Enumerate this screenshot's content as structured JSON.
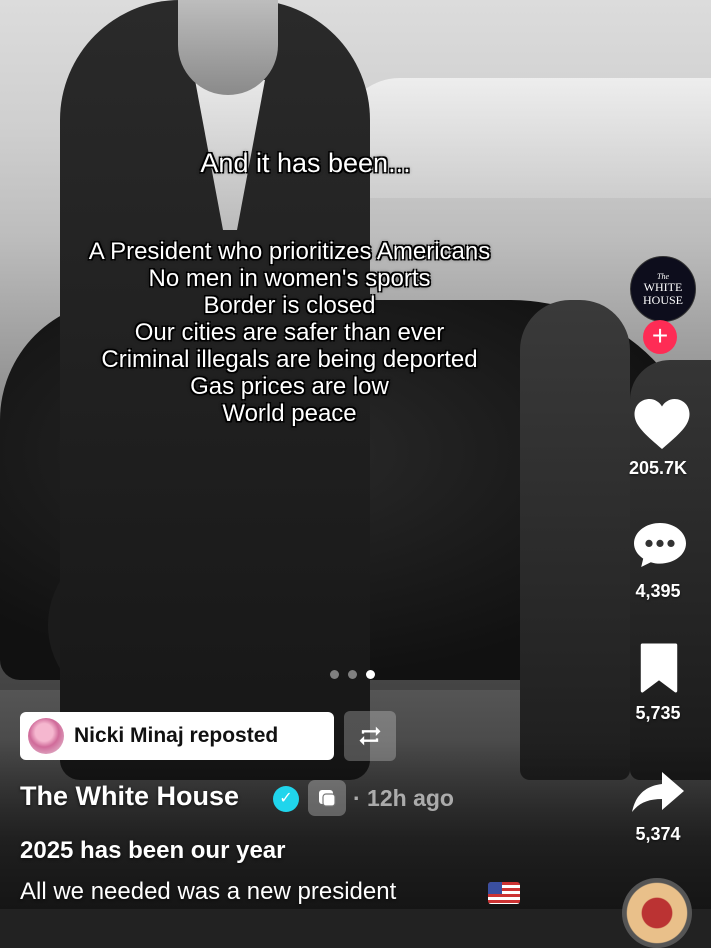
{
  "overlay": {
    "headline": "And it has been...",
    "lines": [
      "A President who prioritizes Americans",
      "No men in women's sports",
      "Border is closed",
      "Our cities are safer than ever",
      "Criminal illegals are being deported",
      "Gas prices are low",
      "World peace"
    ]
  },
  "account_avatar": {
    "small": "The",
    "big1": "WHITE",
    "big2": "HOUSE",
    "icon": "white-house-logo"
  },
  "follow_icon": "plus",
  "actions": {
    "likes": "205.7K",
    "comments": "4,395",
    "saves": "5,735",
    "shares": "5,374"
  },
  "carousel": {
    "total": 3,
    "active": 3
  },
  "repost": {
    "label": "Nicki Minaj reposted",
    "icon": "repost-icon"
  },
  "post": {
    "author": "The White House",
    "verified": true,
    "time": "· 12h ago",
    "caption_title": "2025 has been our year",
    "caption_text": "All we needed was a new president"
  },
  "colors": {
    "follow": "#fe2c55",
    "verified": "#20d5ec"
  }
}
